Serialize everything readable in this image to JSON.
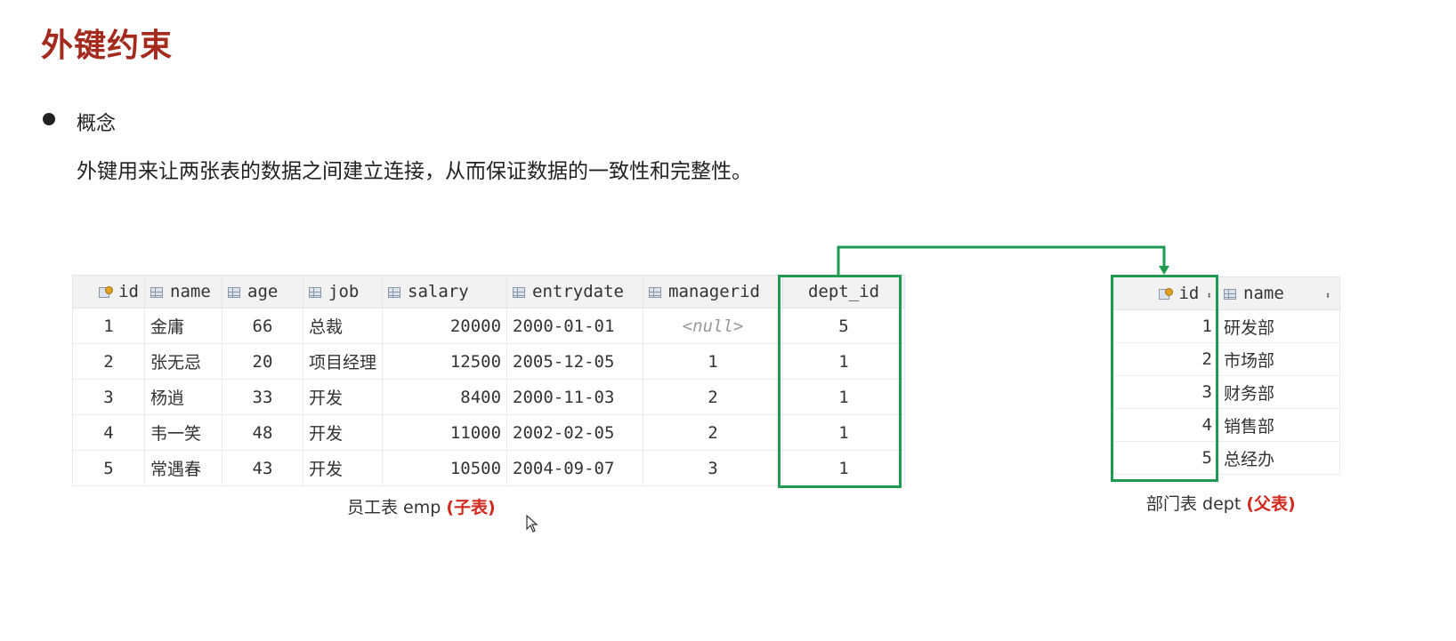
{
  "slide": {
    "title": "外键约束",
    "bullet": "概念",
    "description": "外键用来让两张表的数据之间建立连接，从而保证数据的一致性和完整性。"
  },
  "emp_table": {
    "columns": [
      "id",
      "name",
      "age",
      "job",
      "salary",
      "entrydate",
      "managerid",
      "dept_id"
    ],
    "rows": [
      [
        "1",
        "金庸",
        "66",
        "总裁",
        "20000",
        "2000-01-01",
        "<null>",
        "5"
      ],
      [
        "2",
        "张无忌",
        "20",
        "项目经理",
        "12500",
        "2005-12-05",
        "1",
        "1"
      ],
      [
        "3",
        "杨逍",
        "33",
        "开发",
        "8400",
        "2000-11-03",
        "2",
        "1"
      ],
      [
        "4",
        "韦一笑",
        "48",
        "开发",
        "11000",
        "2002-02-05",
        "2",
        "1"
      ],
      [
        "5",
        "常遇春",
        "43",
        "开发",
        "10500",
        "2004-09-07",
        "3",
        "1"
      ]
    ],
    "caption_prefix": "员工表 emp ",
    "caption_tag": "(子表)"
  },
  "dept_table": {
    "columns": [
      "id",
      "name"
    ],
    "rows": [
      [
        "1",
        "研发部"
      ],
      [
        "2",
        "市场部"
      ],
      [
        "3",
        "财务部"
      ],
      [
        "4",
        "销售部"
      ],
      [
        "5",
        "总经办"
      ]
    ],
    "caption_prefix": "部门表 dept ",
    "caption_tag": "(父表)"
  },
  "colors": {
    "title": "#a52a1e",
    "highlight": "#1f9a52",
    "caption_tag": "#d0281c"
  }
}
